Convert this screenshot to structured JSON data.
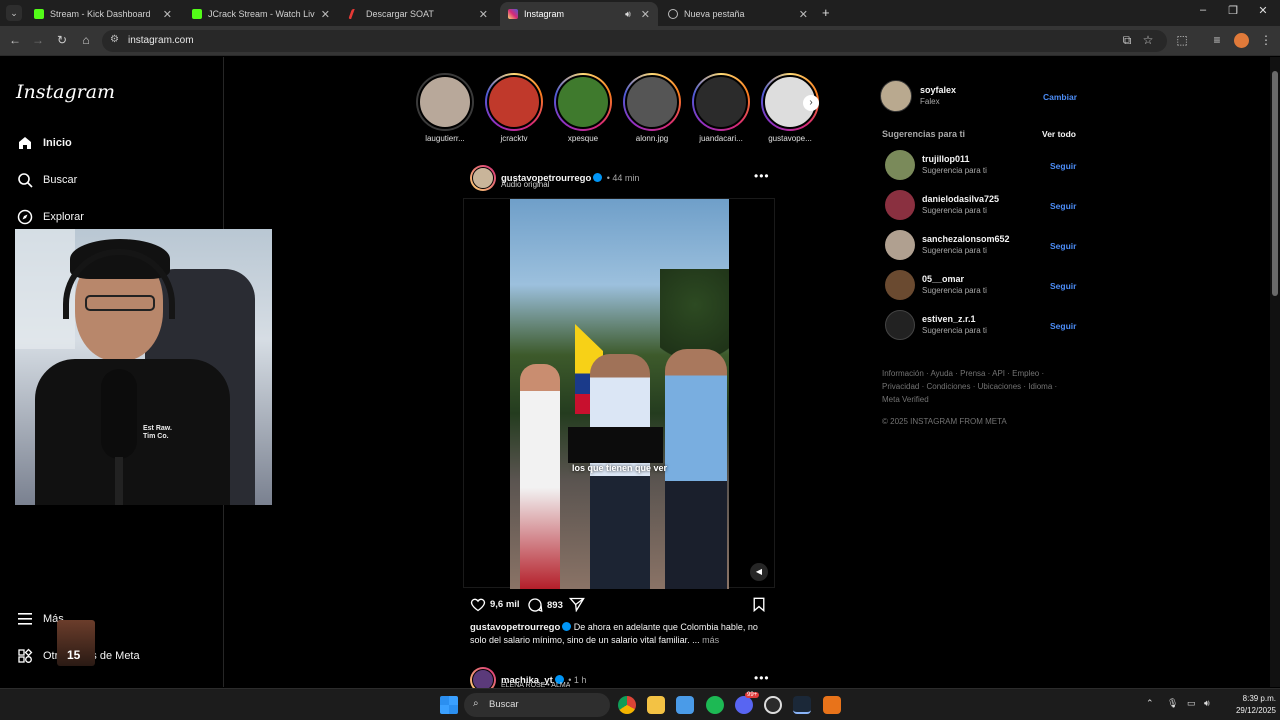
{
  "browser": {
    "tabs": [
      {
        "title": "Stream - Kick Dashboard",
        "color": "#53fc18"
      },
      {
        "title": "JCrack Stream - Watch Live on Kick",
        "color": "#53fc18"
      },
      {
        "title": "Descargar SOAT",
        "color": "#e53935"
      },
      {
        "title": "Instagram",
        "color": "#d62976"
      },
      {
        "title": "Nueva pestaña",
        "color": "#9e9e9e"
      }
    ],
    "url": "instagram.com"
  },
  "sidebar": {
    "logo": "Instagram",
    "items": [
      {
        "label": "Inicio",
        "icon": "home-icon"
      },
      {
        "label": "Buscar",
        "icon": "search-icon"
      },
      {
        "label": "Explorar",
        "icon": "compass-icon"
      },
      {
        "label": "Más",
        "icon": "menu-icon"
      },
      {
        "label": "Otras apps de Meta",
        "icon": "apps-icon"
      }
    ]
  },
  "stories": [
    {
      "label": "laugutierr...",
      "seen": true,
      "color": "#b8a89a"
    },
    {
      "label": "jcracktv",
      "seen": false,
      "color": "#c0392b"
    },
    {
      "label": "xpesque",
      "seen": false,
      "color": "#3f7a2d"
    },
    {
      "label": "alonn.jpg",
      "seen": false,
      "color": "#555"
    },
    {
      "label": "juandacari...",
      "seen": false,
      "color": "#2b2b2b"
    },
    {
      "label": "gustavope...",
      "seen": false,
      "color": "#ddd"
    }
  ],
  "post": {
    "username": "gustavopetrourrego",
    "time": "44 min",
    "audio": "Audio original",
    "video_caption": "los que tienen que ver",
    "likes": "9,6 mil",
    "comments": "893",
    "caption_user": "gustavopetrourrego",
    "caption_text": "De ahora en adelante que Colombia hable, no solo del salario mínimo, sino de un salario vital familiar. ...",
    "more": "más"
  },
  "next_post": {
    "username": "machika_yt",
    "time": "1 h",
    "audio": "ELENA ROSE • ALMA"
  },
  "account": {
    "username": "soyfalex",
    "name": "Falex",
    "switch": "Cambiar"
  },
  "suggestions": {
    "title": "Sugerencias para ti",
    "see_all": "Ver todo",
    "follow_label": "Seguir",
    "items": [
      {
        "name": "trujillop011",
        "sub": "Sugerencia para ti",
        "color": "#7a8a5a"
      },
      {
        "name": "danielodasilva725",
        "sub": "Sugerencia para ti",
        "color": "#8a3040"
      },
      {
        "name": "sanchezalonsom652",
        "sub": "Sugerencia para ti",
        "color": "#b0a090"
      },
      {
        "name": "05__omar",
        "sub": "Sugerencia para ti",
        "color": "#6a4a30"
      },
      {
        "name": "estiven_z.r.1",
        "sub": "Sugerencia para ti",
        "color": "#222"
      }
    ]
  },
  "footer": {
    "links": "Información · Ayuda · Prensa · API · Empleo · Privacidad · Condiciones · Ubicaciones · Idioma · Meta Verified",
    "copyright": "© 2025 INSTAGRAM FROM META"
  },
  "webcam_overlay": {
    "shirt_text": "Est Raw. Tim Co.",
    "emote_number": "15"
  },
  "taskbar": {
    "search": "Buscar",
    "time": "8:39 p.m.",
    "date": "29/12/2025",
    "badge": "99+"
  }
}
